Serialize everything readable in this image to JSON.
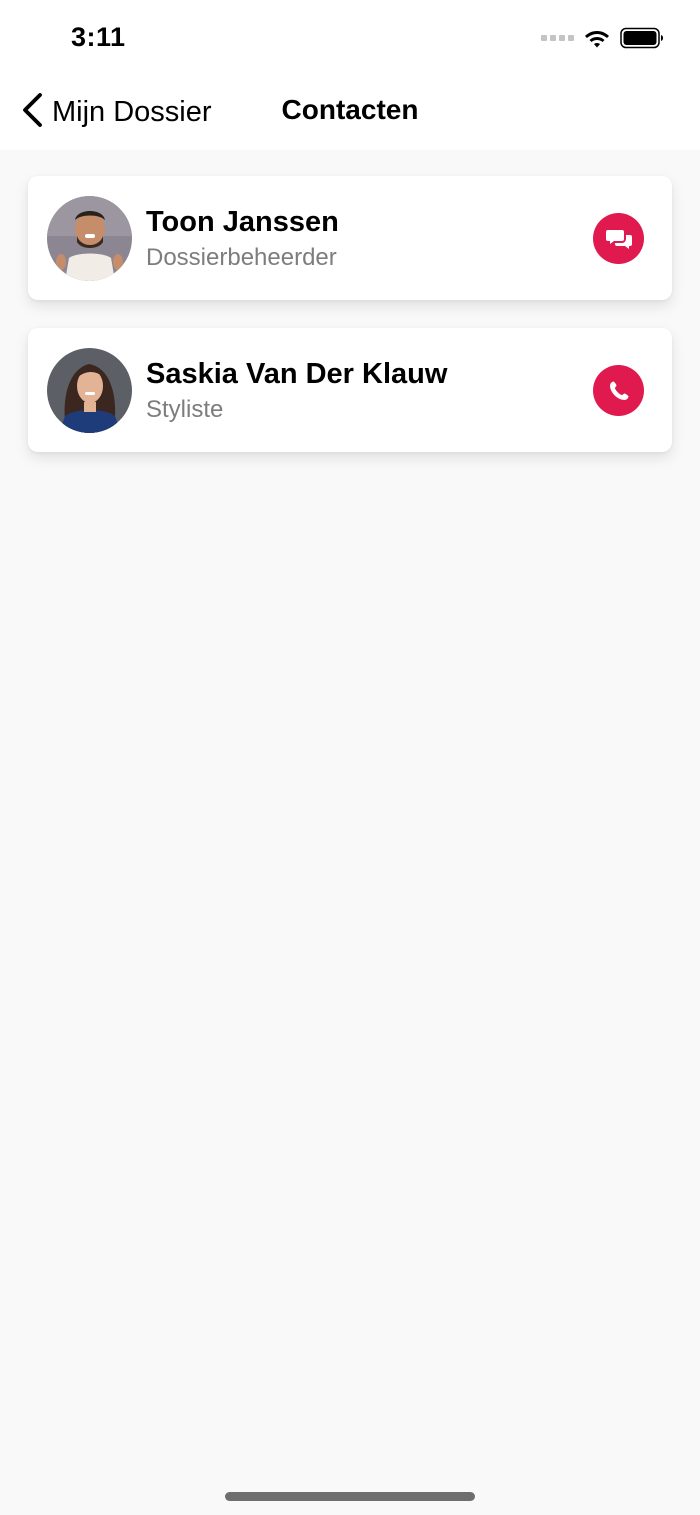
{
  "status_bar": {
    "time": "3:11"
  },
  "nav": {
    "back_label": "Mijn Dossier",
    "title": "Contacten"
  },
  "contacts": [
    {
      "name": "Toon Janssen",
      "role": "Dossierbeheerder",
      "action_icon": "chat-icon"
    },
    {
      "name": "Saskia Van Der Klauw",
      "role": "Styliste",
      "action_icon": "phone-icon"
    }
  ],
  "colors": {
    "accent": "#e0194f",
    "background": "#f9f9f9",
    "secondary_text": "#7d7d7d"
  }
}
